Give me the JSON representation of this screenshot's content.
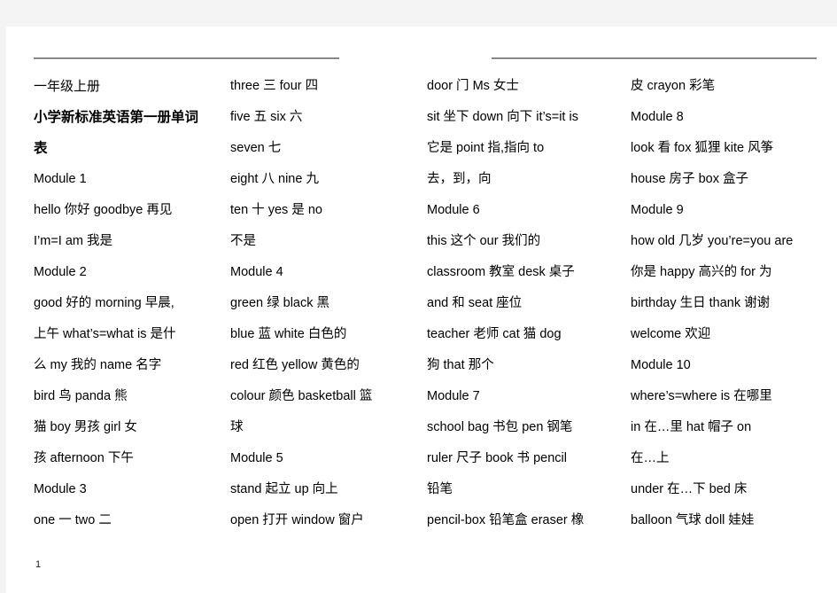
{
  "document": {
    "grade_line": "一年级上册",
    "title": "小学新标准英语第一册单词",
    "title_cont": "表",
    "page_number": "1"
  },
  "columns": [
    {
      "name": "column-1",
      "lines": [
        {
          "id": "c1l1",
          "text": "一年级上册",
          "style": "sub"
        },
        {
          "id": "c1l2",
          "text": "小学新标准英语第一册单词",
          "style": "title"
        },
        {
          "id": "c1l3",
          "text": "表",
          "style": "title"
        },
        {
          "id": "c1l4",
          "text": "Module 1",
          "style": "plain"
        },
        {
          "id": "c1l5",
          "text": "hello 你好      goodbye 再见",
          "style": "plain"
        },
        {
          "id": "c1l6",
          "text": "I’m=I am 我是",
          "style": "plain"
        },
        {
          "id": "c1l7",
          "text": "Module 2",
          "style": "plain"
        },
        {
          "id": "c1l8",
          "text": "good 好的      morning 早晨,",
          "style": "plain"
        },
        {
          "id": "c1l9",
          "text": "上午    what’s=what is 是什",
          "style": "plain"
        },
        {
          "id": "c1l10",
          "text": "么    my 我的   name 名字",
          "style": "plain"
        },
        {
          "id": "c1l11",
          "text": "bird 鸟            panda 熊",
          "style": "plain"
        },
        {
          "id": "c1l12",
          "text": "猫    boy 男孩      girl 女",
          "style": "plain"
        },
        {
          "id": "c1l13",
          "text": "孩     afternoon 下午",
          "style": "plain"
        },
        {
          "id": "c1l14",
          "text": "Module 3",
          "style": "plain"
        },
        {
          "id": "c1l15",
          "text": "one 一           two 二",
          "style": "plain"
        }
      ]
    },
    {
      "name": "column-2",
      "lines": [
        {
          "id": "c2l1",
          "text": "three 三              four 四",
          "style": "plain"
        },
        {
          "id": "c2l2",
          "text": "five 五                 six 六",
          "style": "plain"
        },
        {
          "id": "c2l3",
          "text": "seven 七",
          "style": "plain"
        },
        {
          "id": "c2l4",
          "text": "eight 八              nine 九",
          "style": "plain"
        },
        {
          "id": "c2l5",
          "text": "ten 十       yes 是        no",
          "style": "plain"
        },
        {
          "id": "c2l6",
          "text": "不是",
          "style": "plain"
        },
        {
          "id": "c2l7",
          "text": "Module 4",
          "style": "plain"
        },
        {
          "id": "c2l8",
          "text": "green 绿            black 黑",
          "style": "plain"
        },
        {
          "id": "c2l9",
          "text": "blue 蓝      white 白色的",
          "style": "plain"
        },
        {
          "id": "c2l10",
          "text": "red 红色     yellow 黄色的",
          "style": "plain"
        },
        {
          "id": "c2l11",
          "text": "colour 颜色    basketball 篮",
          "style": "plain"
        },
        {
          "id": "c2l12",
          "text": "球",
          "style": "plain"
        },
        {
          "id": "c2l13",
          "text": "Module 5",
          "style": "plain"
        },
        {
          "id": "c2l14",
          "text": "stand 起立         up 向上",
          "style": "plain"
        },
        {
          "id": "c2l15",
          "text": "open 打开     window 窗户",
          "style": "plain"
        }
      ]
    },
    {
      "name": "column-3",
      "lines": [
        {
          "id": "c3l1",
          "text": "door 门       Ms 女士",
          "style": "plain"
        },
        {
          "id": "c3l2",
          "text": "sit 坐下   down 向下   it’s=it is",
          "style": "plain"
        },
        {
          "id": "c3l3",
          "text": "它是   point 指,指向       to",
          "style": "plain"
        },
        {
          "id": "c3l4",
          "text": "去，到，向",
          "style": "plain"
        },
        {
          "id": "c3l5",
          "text": "Module 6",
          "style": "plain"
        },
        {
          "id": "c3l6",
          "text": "this 这个     our 我们的",
          "style": "plain"
        },
        {
          "id": "c3l7",
          "text": "classroom 教室   desk 桌子",
          "style": "plain"
        },
        {
          "id": "c3l8",
          "text": "and 和 seat 座位",
          "style": "plain"
        },
        {
          "id": "c3l9",
          "text": "teacher 老师   cat 猫   dog",
          "style": "plain"
        },
        {
          "id": "c3l10",
          "text": "狗    that 那个",
          "style": "plain"
        },
        {
          "id": "c3l11",
          "text": "Module 7",
          "style": "plain"
        },
        {
          "id": "c3l12",
          "text": "school bag 书包    pen 钢笔",
          "style": "plain"
        },
        {
          "id": "c3l13",
          "text": "ruler 尺子   book 书  pencil",
          "style": "plain"
        },
        {
          "id": "c3l14",
          "text": "铅笔",
          "style": "plain"
        },
        {
          "id": "c3l15",
          "text": "pencil-box 铅笔盒   eraser 橡",
          "style": "plain"
        }
      ]
    },
    {
      "name": "column-4",
      "lines": [
        {
          "id": "c4l1",
          "text": "皮     crayon 彩笔",
          "style": "plain"
        },
        {
          "id": "c4l2",
          "text": "Module 8",
          "style": "plain"
        },
        {
          "id": "c4l3",
          "text": "look 看   fox 狐狸   kite 风筝",
          "style": "plain"
        },
        {
          "id": "c4l4",
          "text": "house 房子    box 盒子",
          "style": "plain"
        },
        {
          "id": "c4l5",
          "text": "Module 9",
          "style": "plain"
        },
        {
          "id": "c4l6",
          "text": "how old 几岁 you’re=you are",
          "style": "plain"
        },
        {
          "id": "c4l7",
          "text": "你是 happy 高兴的    for 为",
          "style": "plain"
        },
        {
          "id": "c4l8",
          "text": "birthday 生日   thank 谢谢",
          "style": "plain"
        },
        {
          "id": "c4l9",
          "text": "welcome 欢迎",
          "style": "plain"
        },
        {
          "id": "c4l10",
          "text": "Module 10",
          "style": "plain"
        },
        {
          "id": "c4l11",
          "text": "where’s=where  is 在哪里",
          "style": "plain"
        },
        {
          "id": "c4l12",
          "text": "in 在…里    hat 帽子    on",
          "style": "plain"
        },
        {
          "id": "c4l13",
          "text": "在…上",
          "style": "plain"
        },
        {
          "id": "c4l14",
          "text": "under 在…下      bed 床",
          "style": "plain"
        },
        {
          "id": "c4l15",
          "text": "balloon 气球   doll 娃娃",
          "style": "plain"
        }
      ]
    }
  ],
  "colors": {
    "page_background": "#ffffff",
    "canvas_background": "#f4f4f4",
    "text": "#000000",
    "rule": "#555a5e"
  }
}
